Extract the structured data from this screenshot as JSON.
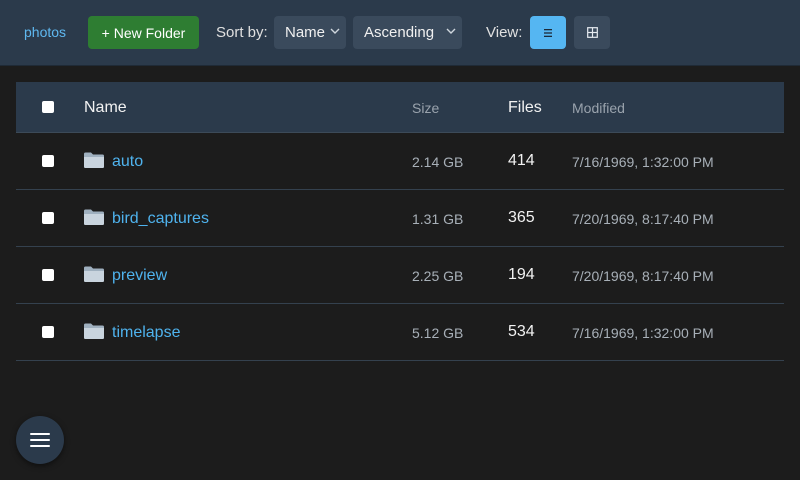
{
  "toolbar": {
    "breadcrumb": "photos",
    "new_folder_label": "+ New Folder",
    "sort_label": "Sort by:",
    "sort_field": "Name",
    "sort_order": "Ascending",
    "view_label": "View:",
    "active_view": "list"
  },
  "table": {
    "headers": {
      "name": "Name",
      "size": "Size",
      "files": "Files",
      "modified": "Modified"
    },
    "rows": [
      {
        "name": "auto",
        "size": "2.14 GB",
        "files": "414",
        "modified": "7/16/1969, 1:32:00 PM"
      },
      {
        "name": "bird_captures",
        "size": "1.31 GB",
        "files": "365",
        "modified": "7/20/1969, 8:17:40 PM"
      },
      {
        "name": "preview",
        "size": "2.25 GB",
        "files": "194",
        "modified": "7/20/1969, 8:17:40 PM"
      },
      {
        "name": "timelapse",
        "size": "5.12 GB",
        "files": "534",
        "modified": "7/16/1969, 1:32:00 PM"
      }
    ]
  },
  "colors": {
    "toolbar_bg": "#2b3a4b",
    "accent": "#55b6f2",
    "link": "#4fb3ee",
    "new_button": "#2e7d32",
    "page_bg": "#1c1c1c"
  },
  "icons": {
    "folder": "folder-icon",
    "list_view": "list-view-icon",
    "grid_view": "grid-view-icon",
    "menu": "hamburger-menu-icon",
    "dropdown": "chevron-down-icon"
  }
}
